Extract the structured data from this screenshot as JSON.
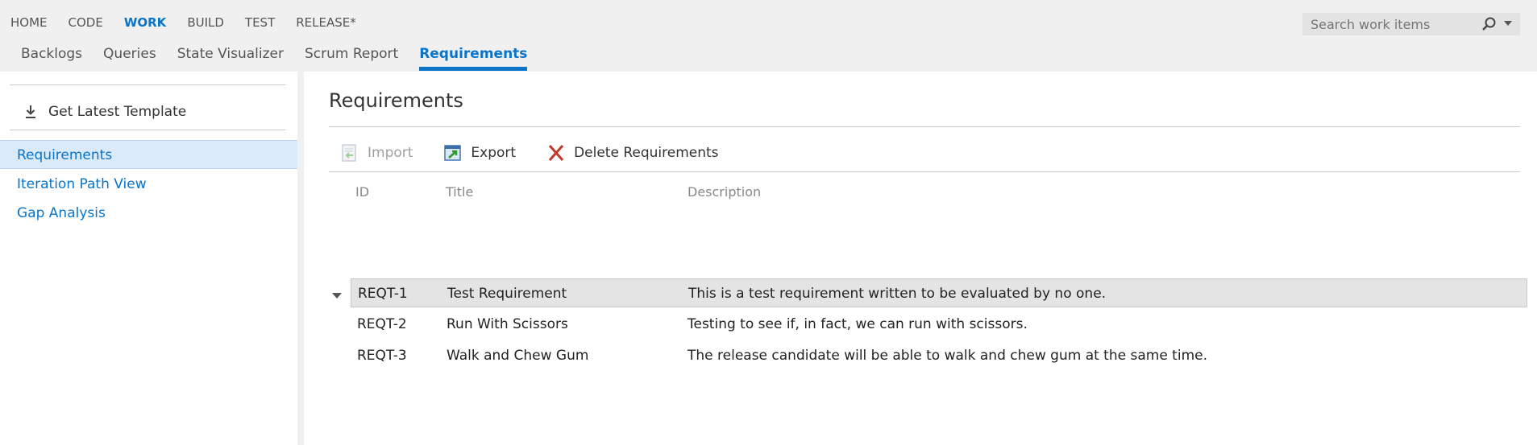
{
  "top_nav": {
    "items": [
      {
        "label": "HOME"
      },
      {
        "label": "CODE"
      },
      {
        "label": "WORK",
        "active": true
      },
      {
        "label": "BUILD"
      },
      {
        "label": "TEST"
      },
      {
        "label": "RELEASE*"
      }
    ]
  },
  "sub_nav": {
    "items": [
      {
        "label": "Backlogs"
      },
      {
        "label": "Queries"
      },
      {
        "label": "State Visualizer"
      },
      {
        "label": "Scrum Report"
      },
      {
        "label": "Requirements",
        "active": true
      }
    ]
  },
  "search": {
    "placeholder": "Search work items",
    "icon": "search-icon"
  },
  "sidebar": {
    "get_latest_label": "Get Latest Template",
    "get_latest_icon": "download-icon",
    "items": [
      {
        "label": "Requirements",
        "selected": true
      },
      {
        "label": "Iteration Path View"
      },
      {
        "label": "Gap Analysis"
      }
    ]
  },
  "main": {
    "title": "Requirements",
    "toolbar": {
      "import_label": "Import",
      "export_label": "Export",
      "delete_label": "Delete Requirements"
    },
    "grid": {
      "columns": [
        "ID",
        "Title",
        "Description"
      ],
      "rows": [
        {
          "id": "REQT-1",
          "title": "Test Requirement",
          "description": "This is a test requirement written to be evaluated by no one.",
          "selected": true
        },
        {
          "id": "REQT-2",
          "title": "Run With Scissors",
          "description": "Testing to see if, in fact, we can run with scissors."
        },
        {
          "id": "REQT-3",
          "title": "Walk and Chew Gum",
          "description": "The release candidate will be able to walk and chew gum at the same time."
        }
      ]
    }
  },
  "colors": {
    "accent": "#0a74c8",
    "header_bg": "#f0f0f0",
    "selected_nav_bg": "#daeaf9",
    "selected_row_bg": "#e4e4e4",
    "delete_icon": "#c0392b"
  }
}
